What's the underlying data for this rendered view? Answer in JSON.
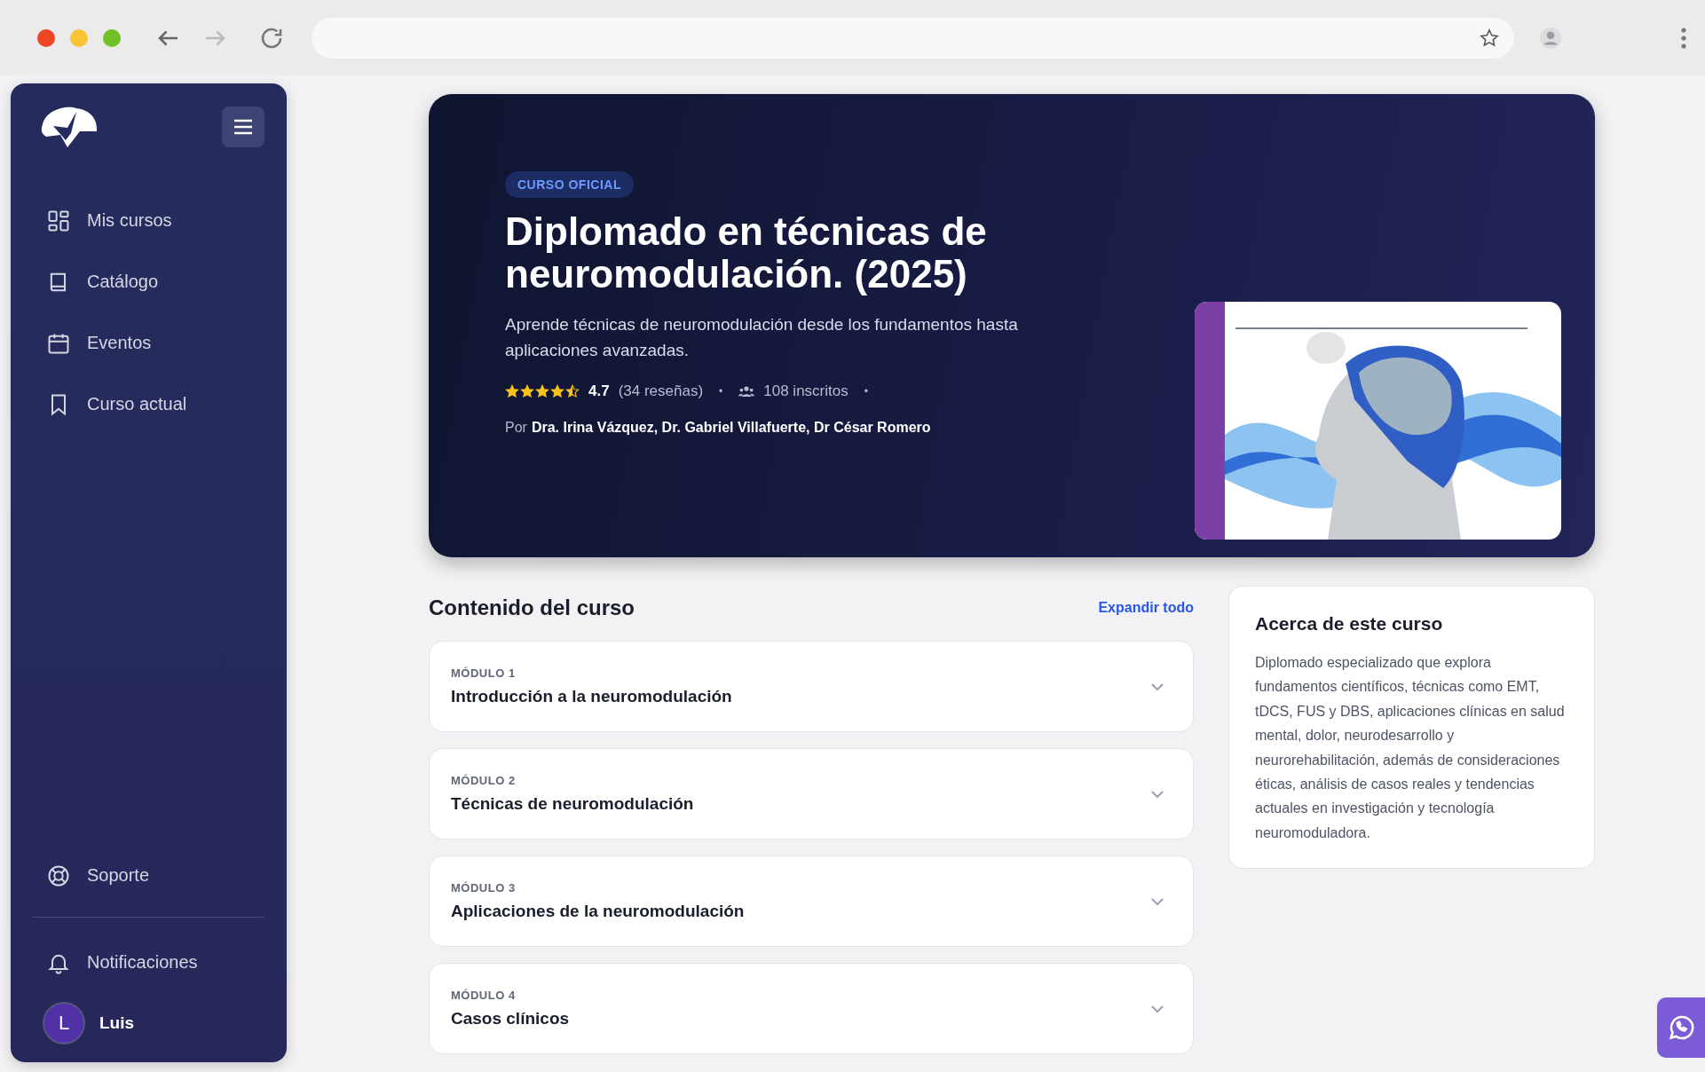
{
  "sidebar": {
    "items": [
      {
        "label": "Mis cursos"
      },
      {
        "label": "Catálogo"
      },
      {
        "label": "Eventos"
      },
      {
        "label": "Curso actual"
      }
    ],
    "bottom_items": [
      {
        "label": "Soporte"
      },
      {
        "label": "Notificaciones"
      }
    ],
    "user": {
      "initial": "L",
      "name": "Luis"
    }
  },
  "hero": {
    "badge": "CURSO OFICIAL",
    "title": "Diplomado en técnicas de neuromodulación. (2025)",
    "subtitle": "Aprende técnicas de neuromodulación desde los fundamentos hasta aplicaciones avanzadas.",
    "stars": 4.5,
    "rating": "4.7",
    "reviews": "(34 reseñas)",
    "separators": [
      "•",
      "•"
    ],
    "enrolled": "108 inscritos",
    "by_label": "Por",
    "instructors": "Dra. Irina Vázquez, Dr. Gabriel Villafuerte, Dr César Romero"
  },
  "content": {
    "heading": "Contenido del curso",
    "expand_all": "Expandir todo",
    "modules": [
      {
        "label": "MÓDULO 1",
        "title": "Introducción a la neuromodulación",
        "expanded": false
      },
      {
        "label": "MÓDULO 2",
        "title": "Técnicas de neuromodulación",
        "expanded": false
      },
      {
        "label": "MÓDULO 3",
        "title": "Aplicaciones de la neuromodulación",
        "expanded": false
      },
      {
        "label": "MÓDULO 4",
        "title": "Casos clínicos",
        "expanded": false
      }
    ]
  },
  "about": {
    "heading": "Acerca de este curso",
    "body": "Diplomado especializado que explora fundamentos científicos, técnicas como EMT, tDCS, FUS y DBS, aplicaciones clínicas en salud mental, dolor, neurodesarrollo y neurorehabilitación, además de consideraciones éticas, análisis de casos reales y tendencias actuales en investigación y tecnología neuromoduladora."
  }
}
